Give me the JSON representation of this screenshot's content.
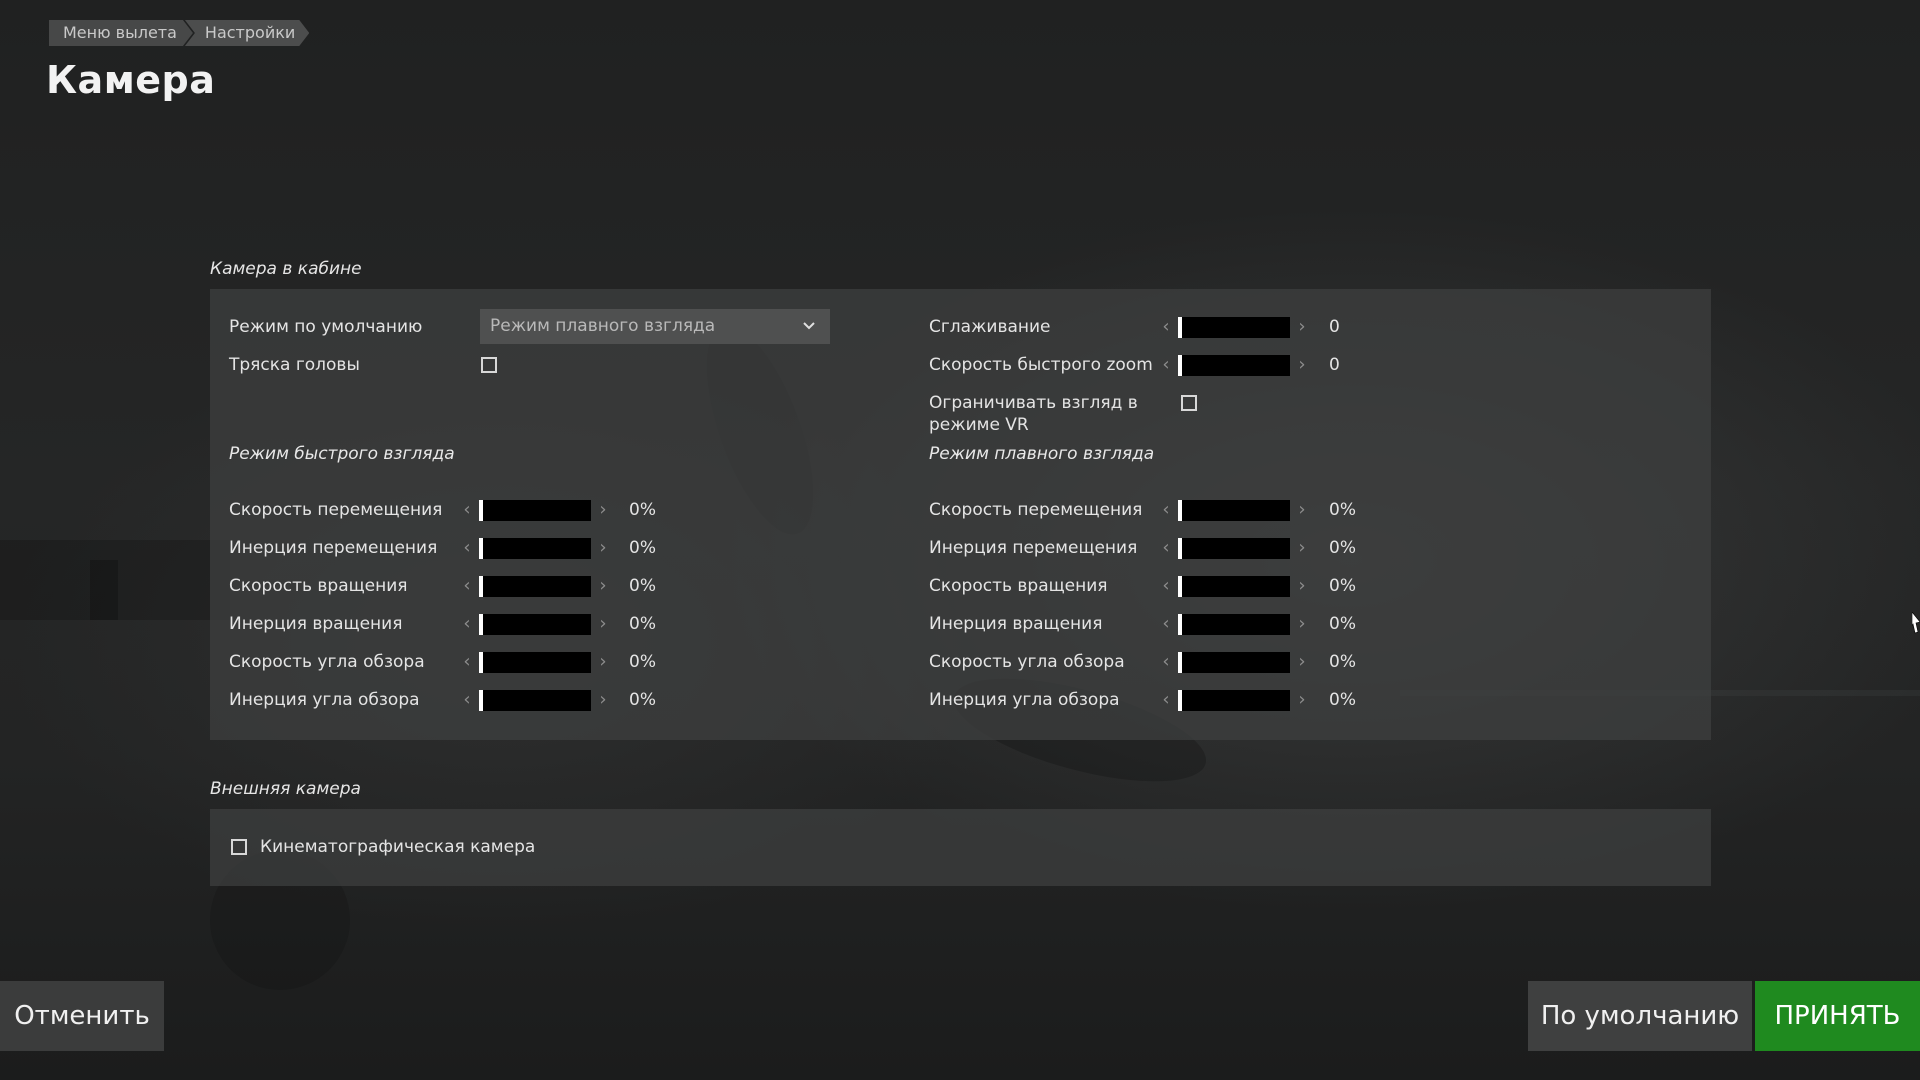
{
  "breadcrumb": {
    "items": [
      "Меню вылета",
      "Настройки"
    ]
  },
  "page_title": "Камера",
  "cockpit_camera": {
    "title": "Камера в кабине",
    "default_mode_label": "Режим по умолчанию",
    "default_mode_value": "Режим плавного взгляда",
    "head_shake_label": "Тряска головы",
    "head_shake_checked": false,
    "smoothing": {
      "label": "Сглаживание",
      "value": "0",
      "level": 0
    },
    "fast_zoom": {
      "label": "Скорость быстрого zoom",
      "value": "0",
      "level": 0
    },
    "vr_limit_label_line1": "Ограничивать взгляд в",
    "vr_limit_label_line2": "режиме VR",
    "vr_limit_checked": false,
    "fast_look": {
      "title": "Режим быстрого взгляда",
      "rows": [
        {
          "label": "Скорость перемещения",
          "value": "0%",
          "level": 0
        },
        {
          "label": "Инерция перемещения",
          "value": "0%",
          "level": 0
        },
        {
          "label": "Скорость вращения",
          "value": "0%",
          "level": 0
        },
        {
          "label": "Инерция вращения",
          "value": "0%",
          "level": 0
        },
        {
          "label": "Скорость угла обзора",
          "value": "0%",
          "level": 0
        },
        {
          "label": "Инерция угла обзора",
          "value": "0%",
          "level": 0
        }
      ]
    },
    "smooth_look": {
      "title": "Режим плавного взгляда",
      "rows": [
        {
          "label": "Скорость перемещения",
          "value": "0%",
          "level": 0
        },
        {
          "label": "Инерция перемещения",
          "value": "0%",
          "level": 0
        },
        {
          "label": "Скорость вращения",
          "value": "0%",
          "level": 0
        },
        {
          "label": "Инерция вращения",
          "value": "0%",
          "level": 0
        },
        {
          "label": "Скорость угла обзора",
          "value": "0%",
          "level": 0
        },
        {
          "label": "Инерция угла обзора",
          "value": "0%",
          "level": 0
        }
      ]
    }
  },
  "external_camera": {
    "title": "Внешняя камера",
    "cinematic_label": "Кинематографическая камера",
    "cinematic_checked": false
  },
  "buttons": {
    "cancel": "Отменить",
    "defaults": "По умолчанию",
    "accept": "ПРИНЯТЬ"
  },
  "colors": {
    "accept": "#1f8a1f",
    "panel": "#3e4040",
    "track": "#000000",
    "thumb": "#ffffff"
  },
  "icons": {
    "dropdown": "chevron-down-icon",
    "slider_left": "chevron-left-icon",
    "slider_right": "chevron-right-icon",
    "cursor": "mouse-cursor-icon"
  }
}
